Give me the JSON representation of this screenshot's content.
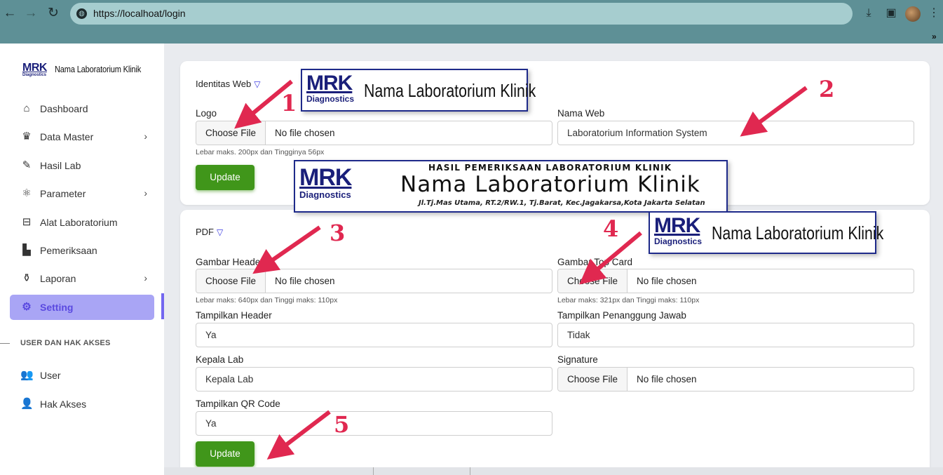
{
  "browser": {
    "url": "https://localhoat/login",
    "more_chevron": "»"
  },
  "sidebar": {
    "brand": {
      "logo_text": "MRK",
      "logo_sub": "Diagnostics",
      "name": "Nama Laboratorium Klinik"
    },
    "items": [
      {
        "label": "Dashboard",
        "icon": "home-icon",
        "arrow": false
      },
      {
        "label": "Data Master",
        "icon": "crown-icon",
        "arrow": true
      },
      {
        "label": "Hasil Lab",
        "icon": "eraser-icon",
        "arrow": false
      },
      {
        "label": "Parameter",
        "icon": "atom-icon",
        "arrow": true
      },
      {
        "label": "Alat Laboratorium",
        "icon": "briefcase-icon",
        "arrow": false
      },
      {
        "label": "Pemeriksaan",
        "icon": "user-clipboard-icon",
        "arrow": false
      },
      {
        "label": "Laporan",
        "icon": "hand-coin-icon",
        "arrow": true
      },
      {
        "label": "Setting",
        "icon": "gear-icon",
        "arrow": false,
        "active": true
      }
    ],
    "section_header": "USER DAN HAK AKSES",
    "user_items": [
      {
        "label": "User",
        "icon": "users-icon"
      },
      {
        "label": "Hak Akses",
        "icon": "user-lock-icon"
      }
    ]
  },
  "identitas": {
    "title": "Identitas Web",
    "logo_label": "Logo",
    "logo_file_button": "Choose File",
    "logo_file_status": "No file chosen",
    "logo_hint": "Lebar maks. 200px dan Tingginya 56px",
    "nama_web_label": "Nama Web",
    "nama_web_value": "Laboratorium Information System",
    "update_label": "Update"
  },
  "pdf": {
    "title": "PDF",
    "header_label": "Gambar Header",
    "header_file_button": "Choose File",
    "header_file_status": "No file chosen",
    "header_hint": "Lebar maks: 640px dan Tinggi maks: 110px",
    "topcard_label": "Gambar Top Card",
    "topcard_file_button": "Choose File",
    "topcard_file_status": "No file chosen",
    "topcard_hint": "Lebar maks: 321px dan Tinggi maks: 110px",
    "tampil_header_label": "Tampilkan Header",
    "tampil_header_value": "Ya",
    "tampil_pj_label": "Tampilkan Penanggung Jawab",
    "tampil_pj_value": "Tidak",
    "kepala_lab_label": "Kepala Lab",
    "kepala_lab_value": "Kepala Lab",
    "signature_label": "Signature",
    "signature_file_button": "Choose File",
    "signature_file_status": "No file chosen",
    "qr_label": "Tampilkan QR Code",
    "qr_value": "Ya",
    "update_label": "Update"
  },
  "overlays": {
    "logo_text": "MRK",
    "logo_sub": "Diagnostics",
    "lab_name": "Nama Laboratorium Klinik",
    "report_title": "HASIL PEMERIKSAAN LABORATORIUM KLINIK",
    "report_address": "Jl.Tj.Mas Utama, RT.2/RW.1, Tj.Barat, Kec.Jagakarsa,Kota Jakarta Selatan"
  },
  "annotations": [
    "1",
    "2",
    "3",
    "4",
    "5"
  ],
  "colors": {
    "browser_bar": "#5e9096",
    "active_menu_bg": "#a9a5f5",
    "active_menu_text": "#5a49e0",
    "update_button": "#40961a",
    "annotation_red": "#e02850",
    "logo_blue": "#1a1f7a"
  }
}
